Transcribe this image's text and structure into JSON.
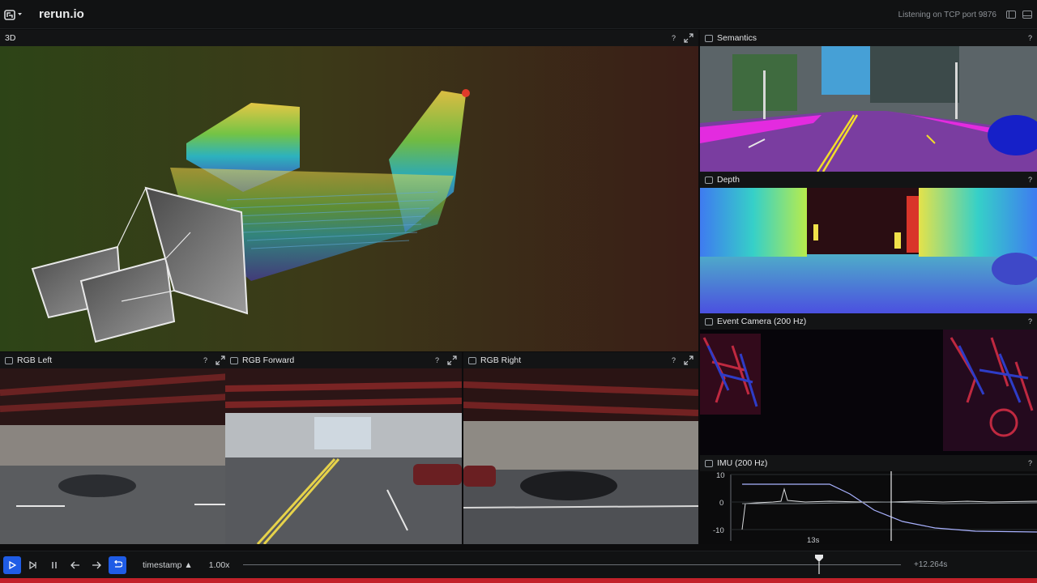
{
  "app": {
    "title": "rerun.io",
    "status": "Listening on TCP port 9876"
  },
  "views": {
    "view3d": {
      "title": "3D",
      "help": "?"
    },
    "semantics": {
      "title": "Semantics",
      "help": "?"
    },
    "depth": {
      "title": "Depth",
      "help": "?"
    },
    "event_camera": {
      "title": "Event Camera (200 Hz)",
      "help": "?"
    },
    "rgb_left": {
      "title": "RGB Left",
      "help": "?"
    },
    "rgb_forward": {
      "title": "RGB Forward",
      "help": "?"
    },
    "rgb_right": {
      "title": "RGB Right",
      "help": "?"
    },
    "imu": {
      "title": "IMU (200 Hz)",
      "help": "?",
      "y_ticks": [
        "10",
        "0",
        "-10"
      ],
      "x_tick": "13s"
    }
  },
  "timeline": {
    "timeline_name": "timestamp ▲",
    "speed": "1.00x",
    "time_readout": "+12.264s",
    "cursor_fraction": 0.876,
    "accent_color": "#1f5ce6"
  },
  "icons": [
    "rerun-logo-icon",
    "chevron-down-icon",
    "left-panel-icon",
    "bottom-panel-icon",
    "view-tab-icon",
    "help-icon",
    "expand-icon",
    "play-icon",
    "step-end-icon",
    "pause-icon",
    "arrow-left-icon",
    "arrow-right-icon",
    "loop-icon",
    "dropdown-icon"
  ]
}
